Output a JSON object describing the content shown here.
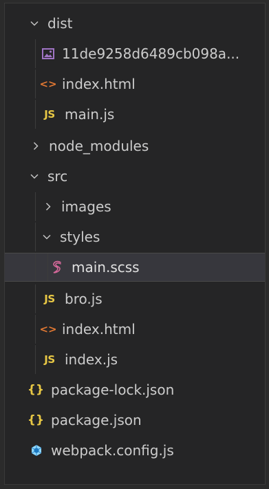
{
  "explorer": {
    "items": [
      {
        "label": "dist",
        "kind": "folder",
        "state": "expanded",
        "depth": 1
      },
      {
        "label": "11de9258d6489cb098a...",
        "kind": "image",
        "depth": 2
      },
      {
        "label": "index.html",
        "kind": "html",
        "depth": 2
      },
      {
        "label": "main.js",
        "kind": "js",
        "depth": 2
      },
      {
        "label": "node_modules",
        "kind": "folder",
        "state": "collapsed",
        "depth": 1
      },
      {
        "label": "src",
        "kind": "folder",
        "state": "expanded",
        "depth": 1
      },
      {
        "label": "images",
        "kind": "folder",
        "state": "collapsed",
        "depth": 2
      },
      {
        "label": "styles",
        "kind": "folder",
        "state": "expanded",
        "depth": 2
      },
      {
        "label": "main.scss",
        "kind": "scss",
        "depth": 3,
        "selected": true
      },
      {
        "label": "bro.js",
        "kind": "js",
        "depth": 2
      },
      {
        "label": "index.html",
        "kind": "html",
        "depth": 2
      },
      {
        "label": "index.js",
        "kind": "js",
        "depth": 2
      },
      {
        "label": "package-lock.json",
        "kind": "json",
        "depth": 1
      },
      {
        "label": "package.json",
        "kind": "json",
        "depth": 1
      },
      {
        "label": "webpack.config.js",
        "kind": "webpack",
        "depth": 1
      }
    ],
    "icons": {
      "js_text": "JS",
      "html_text": "<>",
      "json_text": "{}"
    },
    "colors": {
      "background": "#252526",
      "text": "#cccccc",
      "selected_row": "#37373d",
      "js": "#e8c845",
      "html": "#e37933",
      "json": "#e8c845",
      "scss": "#d4689a",
      "webpack": "#8ed6fb",
      "image": "#a074c4"
    }
  }
}
